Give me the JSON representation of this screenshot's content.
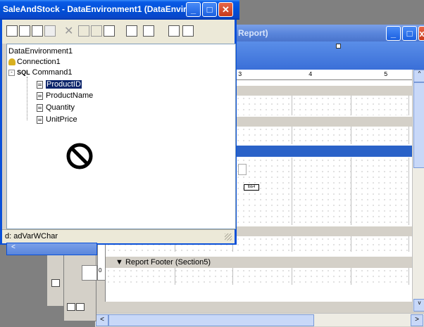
{
  "data_env_window": {
    "title": "SaleAndStock - DataEnvironment1 (DataEnviro...",
    "status": "d: adVarWChar",
    "tree": {
      "root": "DataEnvironment1",
      "connection": "Connection1",
      "command": "Command1",
      "command_badge": "SQL",
      "fields": [
        "ProductID",
        "ProductName",
        "Quantity",
        "UnitPrice"
      ],
      "selected_field": "ProductID"
    },
    "cursor": "no-drop cursor"
  },
  "report_window": {
    "title_fragment": "Report)",
    "ruler_numbers": [
      "3",
      "4",
      "5"
    ],
    "footer_label": "Report Footer (Section5)",
    "control_label": "lblx4"
  },
  "colors": {
    "xp_blue": "#0a50d8",
    "selection_blue": "#0a246a",
    "close_red": "#d8421e"
  },
  "icons": [
    "minimize-icon",
    "maximize-icon",
    "close-icon",
    "sql-icon",
    "connection-icon",
    "field-icon",
    "scroll-left-icon",
    "scroll-right-icon"
  ]
}
